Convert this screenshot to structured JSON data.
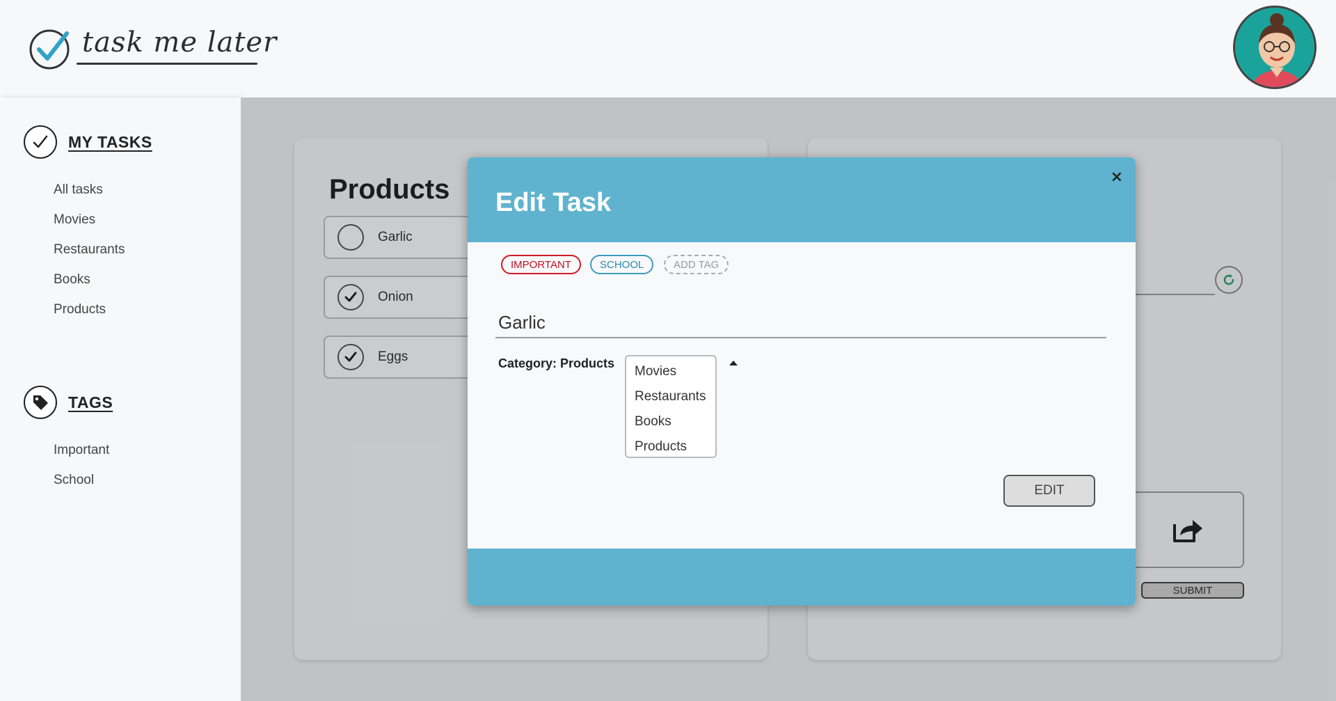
{
  "header": {
    "app_name": "task me later"
  },
  "sidebar": {
    "tasks_title": "MY TASKS",
    "task_items": [
      "All tasks",
      "Movies",
      "Restaurants",
      "Books",
      "Products"
    ],
    "tags_title": "TAGS",
    "tag_items": [
      "Important",
      "School"
    ]
  },
  "main": {
    "list_title": "Products",
    "tasks": [
      {
        "label": "Garlic",
        "done": false
      },
      {
        "label": "Onion",
        "done": true
      },
      {
        "label": "Eggs",
        "done": true
      }
    ],
    "submit_label": "SUBMIT"
  },
  "modal": {
    "title": "Edit Task",
    "close": "×",
    "tags": {
      "important": "IMPORTANT",
      "school": "SCHOOL",
      "add": "ADD TAG"
    },
    "task_value": "Garlic",
    "category_label": "Category:",
    "category_value": "Products",
    "category_options": [
      "Movies",
      "Restaurants",
      "Books",
      "Products"
    ],
    "edit_label": "EDIT"
  },
  "colors": {
    "accent": "#5fb3cf",
    "important": "#d11a2a",
    "school": "#3b9bbf"
  }
}
